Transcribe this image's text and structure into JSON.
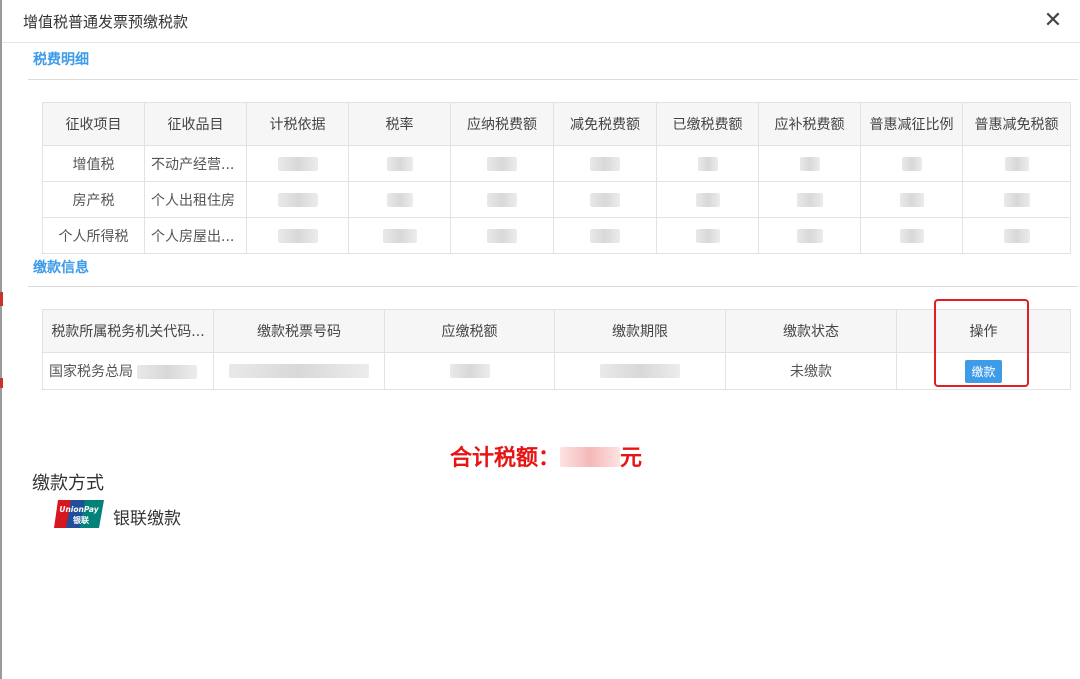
{
  "window": {
    "title": "增值税普通发票预缴税款",
    "close_label": "✕"
  },
  "sections": {
    "tax_detail": "税费明细",
    "payment_info": "缴款信息"
  },
  "tax_table": {
    "headers": [
      "征收项目",
      "征收品目",
      "计税依据",
      "税率",
      "应纳税费额",
      "减免税费额",
      "已缴税费额",
      "应补税费额",
      "普惠减征比例",
      "普惠减免税额"
    ],
    "rows": [
      [
        "增值税",
        "不动产经营..."
      ],
      [
        "房产税",
        "个人出租住房"
      ],
      [
        "个人所得税",
        "个人房屋出..."
      ]
    ]
  },
  "payment_table": {
    "headers": [
      "税款所属税务机关代码...",
      "缴款税票号码",
      "应缴税额",
      "缴款期限",
      "缴款状态",
      "操作"
    ],
    "rows": [
      {
        "authority": "国家税务总局",
        "status": "未缴款",
        "action": "缴款"
      }
    ]
  },
  "total": {
    "label": "合计税额：",
    "unit": "元"
  },
  "payment_method": {
    "title": "缴款方式",
    "logo_text_top": "UnionPay",
    "logo_text_bottom": "银联",
    "option_label": "银联缴款"
  },
  "colors": {
    "accent": "#3e9be8",
    "highlight": "#e02020",
    "total": "#e81414"
  }
}
